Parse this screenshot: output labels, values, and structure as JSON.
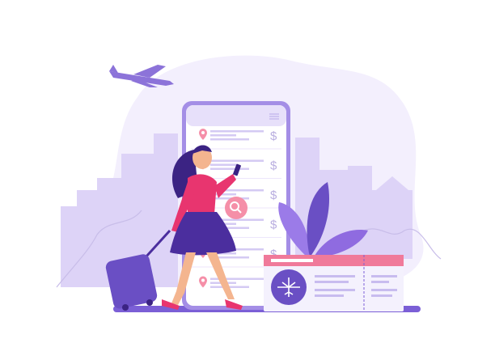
{
  "phone": {
    "currency_symbol": "$",
    "rows": 6
  },
  "colors": {
    "primary": "#6a4fc4",
    "light_purple": "#ece6fb",
    "city": "#d9cff5",
    "accent_pink": "#f07a9a",
    "shirt": "#e8356f",
    "skirt": "#4b2e9e"
  }
}
